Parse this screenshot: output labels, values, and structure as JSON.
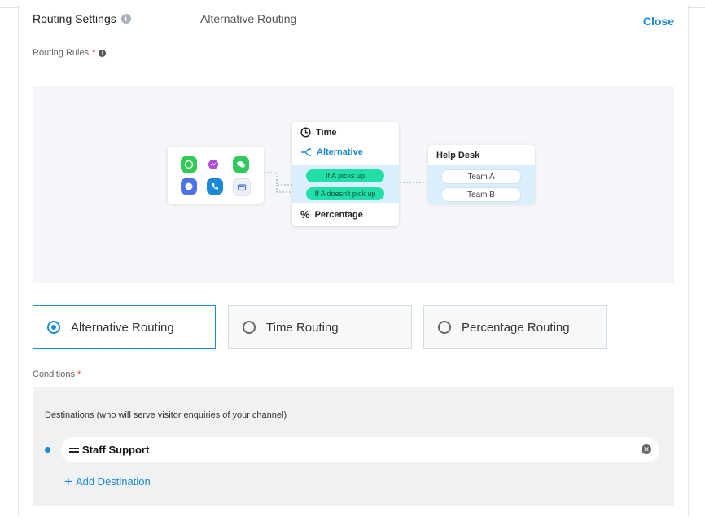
{
  "header": {
    "title": "Routing Settings",
    "subtitle": "Alternative Routing",
    "close_label": "Close"
  },
  "routing_rules": {
    "label": "Routing Rules",
    "required_mark": "*"
  },
  "diagram": {
    "apps": [
      "whatsapp-icon",
      "messenger-icon",
      "wechat-icon",
      "chat-icon",
      "phone-icon",
      "webchat-icon"
    ],
    "route_options": {
      "time": "Time",
      "alternative": "Alternative",
      "percentage": "Percentage"
    },
    "conditions": {
      "picks_up": "If A picks up",
      "no_pick_up": "If A doesn't pick up"
    },
    "help_desk": {
      "title": "Help Desk",
      "team_a": "Team A",
      "team_b": "Team B"
    }
  },
  "routing_options": [
    {
      "label": "Alternative Routing",
      "selected": true
    },
    {
      "label": "Time Routing",
      "selected": false
    },
    {
      "label": "Percentage Routing",
      "selected": false
    }
  ],
  "conditions": {
    "label": "Conditions",
    "required_mark": "*",
    "destinations_hint": "Destinations (who will serve visitor enquiries of your channel)",
    "destinations": [
      {
        "name": "Staff Support"
      }
    ],
    "add_destination_label": "Add Destination"
  },
  "colors": {
    "accent": "#1a8ad6",
    "green_pill": "#20e0a8",
    "band": "#dbeefb"
  }
}
